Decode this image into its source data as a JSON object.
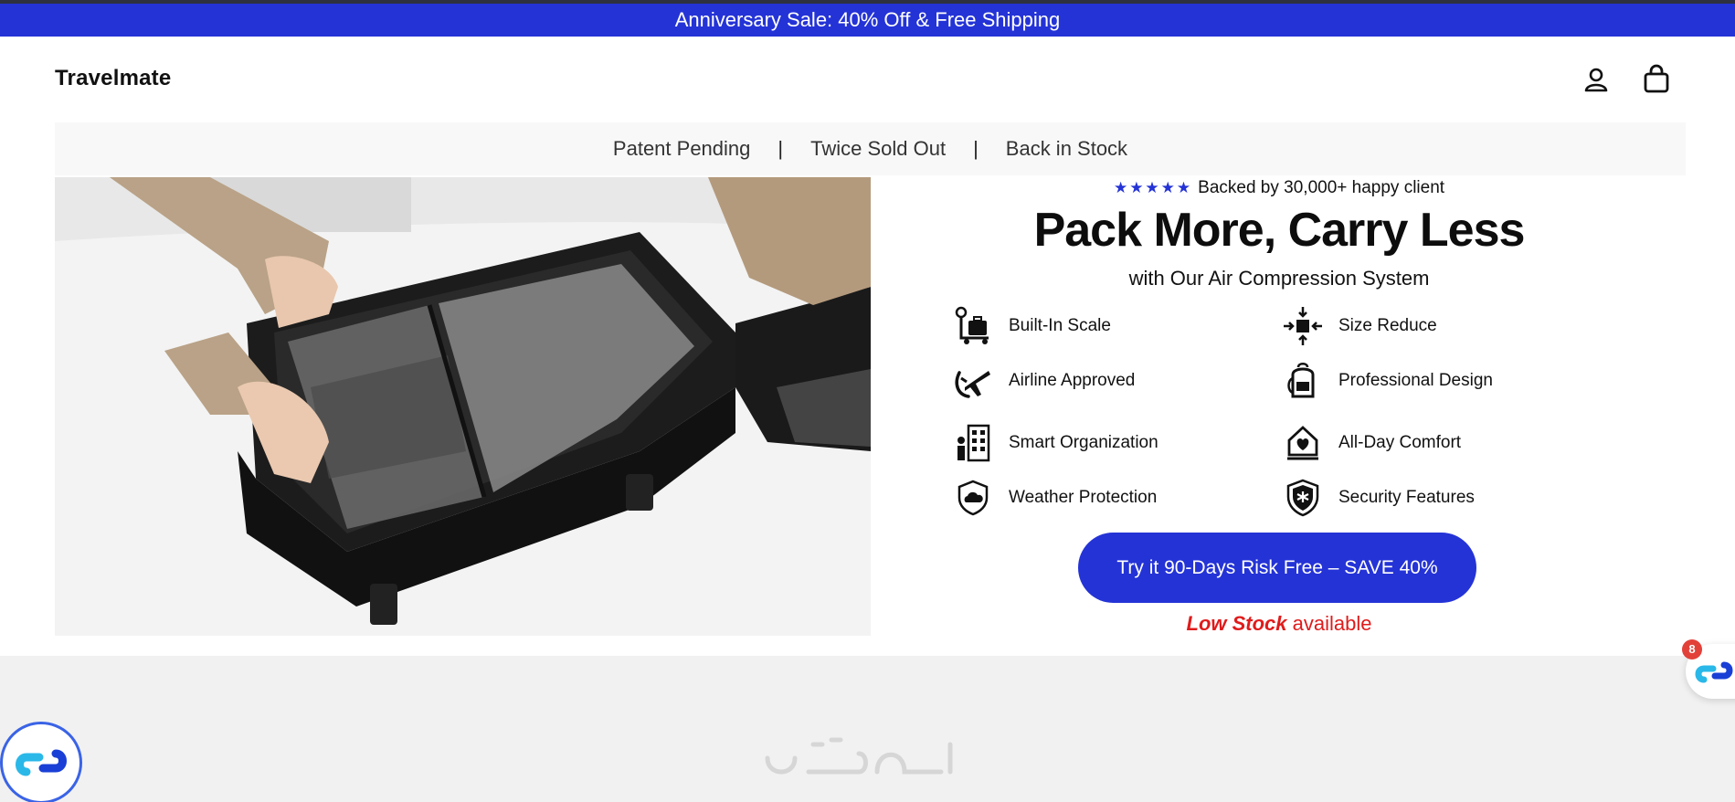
{
  "announcement": {
    "text": "Anniversary Sale: 40% Off & Free Shipping"
  },
  "header": {
    "logo": "Travelmate",
    "icons": [
      "account-icon",
      "shopping-bag-icon"
    ]
  },
  "trust_bar": {
    "items": [
      "Patent Pending",
      "Twice Sold Out",
      "Back in Stock"
    ],
    "separator": "|"
  },
  "hero": {
    "rating_stars": "★★★★★",
    "rating_text": "Backed by 30,000+ happy client",
    "title": "Pack More, Carry Less",
    "subtitle": "with Our Air Compression System",
    "features": [
      {
        "label": "Built-In Scale",
        "icon": "luggage-scale-icon"
      },
      {
        "label": "Size Reduce",
        "icon": "compress-arrows-icon"
      },
      {
        "label": "Airline Approved",
        "icon": "airplane-check-icon"
      },
      {
        "label": "Professional Design",
        "icon": "backpack-icon"
      },
      {
        "label": "Smart Organization",
        "icon": "organizer-shelves-icon"
      },
      {
        "label": "All-Day Comfort",
        "icon": "heart-house-icon"
      },
      {
        "label": "Weather Protection",
        "icon": "weather-shield-icon"
      },
      {
        "label": "Security Features",
        "icon": "security-shield-icon"
      }
    ],
    "cta_label": "Try it 90-Days Risk Free – SAVE 40%",
    "stock_emphasis": "Low Stock",
    "stock_rest": " available"
  },
  "widgets": {
    "chat_badge_count": "8",
    "left_widget_icon": "chain-link-icon",
    "right_widget_icon": "chain-link-icon"
  },
  "colors": {
    "accent": "#2433d6",
    "warning": "#e01b1b",
    "announcement_bg": "#2433d6",
    "lower_section_bg": "#f1f1f1"
  }
}
